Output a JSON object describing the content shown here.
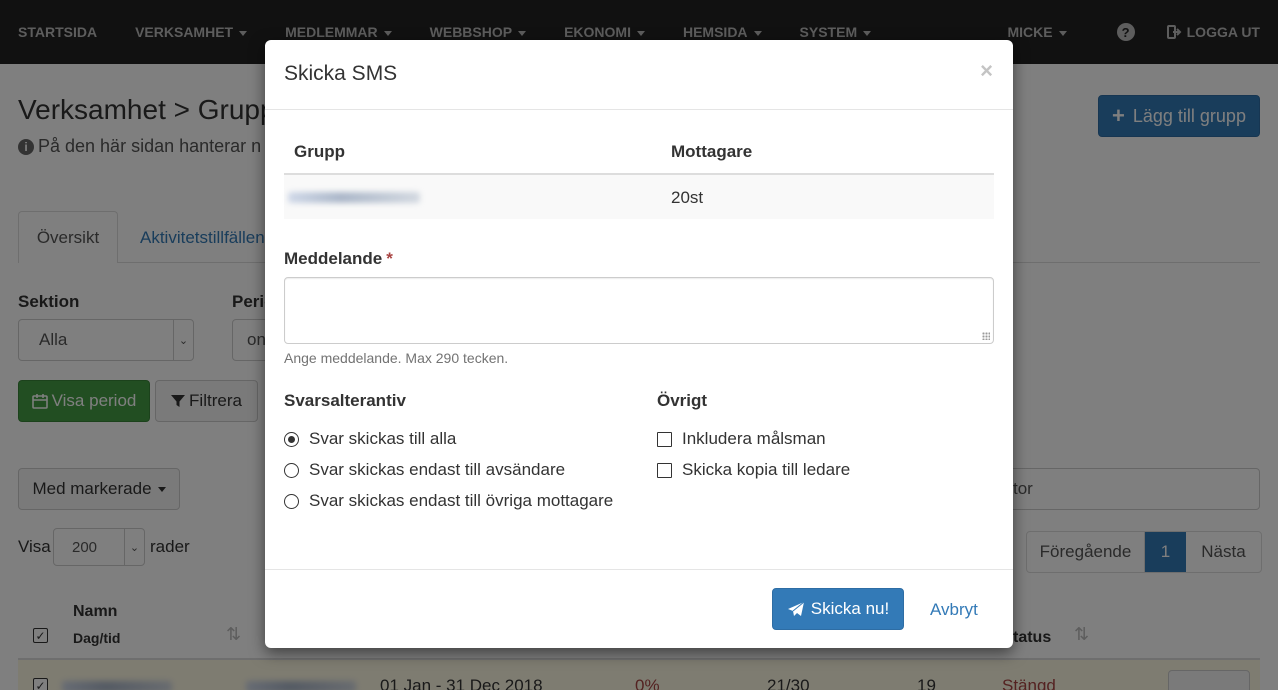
{
  "nav": {
    "items": [
      {
        "label": "STARTSIDA",
        "caret": false
      },
      {
        "label": "VERKSAMHET",
        "caret": true
      },
      {
        "label": "MEDLEMMAR",
        "caret": true
      },
      {
        "label": "WEBBSHOP",
        "caret": true
      },
      {
        "label": "EKONOMI",
        "caret": true
      },
      {
        "label": "HEMSIDA",
        "caret": true
      },
      {
        "label": "SYSTEM",
        "caret": true
      }
    ],
    "user": "MICKE",
    "help_glyph": "?",
    "logout": "LOGGA UT"
  },
  "page": {
    "title": "Verksamhet > Grupp",
    "info": "På den här sidan hanterar n",
    "add_group_button": "Lägg till grupp",
    "tabs": [
      "Översikt",
      "Aktivitetstillfällen"
    ],
    "section_label": "Sektion",
    "section_value": "Alla",
    "period_label": "Perio",
    "period_value": "on",
    "show_period_button": "Visa period",
    "filter_button": "Filtrera",
    "bulk_button": "Med markerade",
    "show_label": "Visa",
    "rows_value": "200",
    "rows_label": "rader",
    "search_fragment": "tor",
    "pager": {
      "prev": "Föregående",
      "current": "1",
      "next": "Nästa"
    },
    "table": {
      "col_name": "Namn",
      "col_name_sub": "Dag/tid",
      "col_status": "tatus",
      "row": {
        "period": "01 Jan - 31 Dec 2018",
        "percent": "0%",
        "count": "21/30",
        "num": "19",
        "status": "Stängd"
      }
    }
  },
  "modal": {
    "title": "Skicka SMS",
    "close": "×",
    "table_headers": {
      "group": "Grupp",
      "recipients": "Mottagare"
    },
    "row": {
      "recipients": "20st"
    },
    "message_label": "Meddelande",
    "required_mark": "*",
    "message_value": "",
    "message_help": "Ange meddelande. Max 290 tecken.",
    "reply_label": "Svarsalterantiv",
    "reply_options": [
      {
        "label": "Svar skickas till alla",
        "checked": true
      },
      {
        "label": "Svar skickas endast till avsändare",
        "checked": false
      },
      {
        "label": "Svar skickas endast till övriga mottagare",
        "checked": false
      }
    ],
    "other_label": "Övrigt",
    "other_options": [
      {
        "label": "Inkludera målsman",
        "checked": false
      },
      {
        "label": "Skicka kopia till ledare",
        "checked": false
      }
    ],
    "send_button": "Skicka nu!",
    "cancel": "Avbryt"
  }
}
